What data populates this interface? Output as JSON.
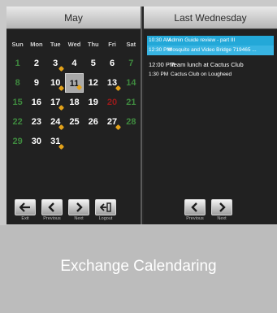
{
  "left_panel": {
    "title": "May"
  },
  "right_panel": {
    "title": "Last Wednesday"
  },
  "weekdays": [
    "Sun",
    "Mon",
    "Tue",
    "Wed",
    "Thu",
    "Fri",
    "Sat"
  ],
  "weeks": [
    [
      "1",
      "2",
      "3",
      "4",
      "5",
      "6",
      "7"
    ],
    [
      "8",
      "9",
      "10",
      "11",
      "12",
      "13",
      "14"
    ],
    [
      "15",
      "16",
      "17",
      "18",
      "19",
      "20",
      "21"
    ],
    [
      "22",
      "23",
      "24",
      "25",
      "26",
      "27",
      "28"
    ],
    [
      "29",
      "30",
      "31",
      "",
      "",
      "",
      ""
    ]
  ],
  "today": "11",
  "events": [
    {
      "time": "10:30 AM",
      "title": "Admin Guide review - part III",
      "selected": true
    },
    {
      "time": "12:30 PM",
      "title": "Mosquito and Video Bridge 719465 ...",
      "selected": true
    },
    {
      "time": "12:00 PM",
      "title": "Team lunch at Cactus Club",
      "selected": false
    },
    {
      "time": "1:30 PM",
      "title": "Cactus Club on Lougheed",
      "selected": false
    }
  ],
  "left_nav": {
    "exit_label": "Exit",
    "previous_label": "Previous",
    "next_label": "Next",
    "logout_label": "Logout"
  },
  "right_nav": {
    "previous_label": "Previous",
    "next_label": "Next"
  },
  "caption": "Exchange Calendaring"
}
